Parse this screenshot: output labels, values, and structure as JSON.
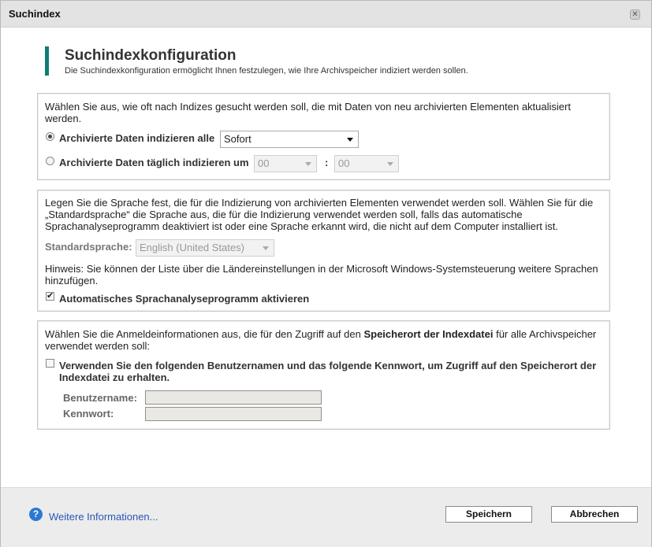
{
  "window": {
    "title": "Suchindex"
  },
  "header": {
    "title": "Suchindexkonfiguration",
    "subtitle": "Die Suchindexkonfiguration ermöglicht Ihnen festzulegen, wie Ihre Archivspeicher indiziert werden sollen."
  },
  "schedule": {
    "description": "Wählen Sie aus, wie oft nach Indizes gesucht werden soll, die mit Daten von neu archivierten Elementen aktualisiert werden.",
    "option_interval_label": "Archivierte Daten indizieren alle",
    "interval_value": "Sofort",
    "option_daily_label": "Archivierte Daten täglich indizieren um",
    "hour_value": "00",
    "minute_value": "00",
    "time_separator": ":"
  },
  "language": {
    "description": "Legen Sie die Sprache fest, die für die Indizierung von archivierten Elementen verwendet werden soll. Wählen Sie für die „Standardsprache“ die Sprache aus, die für die Indizierung verwendet werden soll, falls das automatische Sprachanalyseprogramm deaktiviert ist oder eine Sprache erkannt wird, die nicht auf dem Computer installiert ist.",
    "default_label": "Standardsprache:",
    "default_value": "English (United States)",
    "hint": "Hinweis: Sie können der Liste über die Ländereinstellungen in der Microsoft Windows-Systemsteuerung weitere Sprachen hinzufügen.",
    "auto_analyzer_label": "Automatisches Sprachanalyseprogramm aktivieren"
  },
  "credentials": {
    "description_pre": "Wählen Sie die Anmeldeinformationen aus, die für den Zugriff auf den ",
    "description_bold": "Speicherort der Indexdatei",
    "description_post": " für alle Archivspeicher verwendet werden soll:",
    "use_credentials_label": "Verwenden Sie den folgenden Benutzernamen und das folgende Kennwort, um Zugriff auf den Speicherort der Indexdatei zu erhalten.",
    "username_label": "Benutzername:",
    "password_label": "Kennwort:"
  },
  "footer": {
    "help_link": "Weitere Informationen...",
    "help_icon_glyph": "?",
    "save_label": "Speichern",
    "cancel_label": "Abbrechen"
  }
}
